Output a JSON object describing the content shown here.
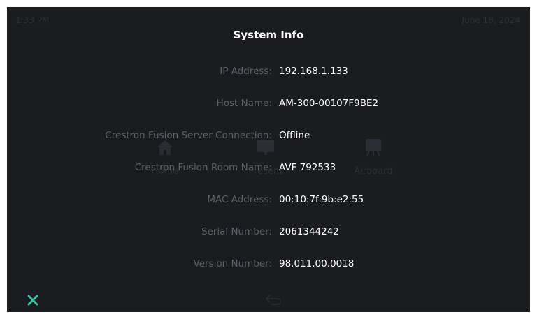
{
  "background": {
    "time": "1:33 PM",
    "date": "June 18, 2024",
    "tiles": [
      {
        "label": "Home",
        "icon": "home-icon"
      },
      {
        "label": "Present",
        "icon": "present-icon"
      },
      {
        "label": "Airboard",
        "icon": "airboard-icon"
      }
    ]
  },
  "dialog": {
    "title": "System Info",
    "rows": [
      {
        "label": "IP Address:",
        "value": "192.168.1.133"
      },
      {
        "label": "Host Name:",
        "value": "AM-300-00107F9BE2"
      },
      {
        "label": "Crestron Fusion Server Connection:",
        "value": "Offline"
      },
      {
        "label": "Crestron Fusion Room Name:",
        "value": "AVF 792533"
      },
      {
        "label": "MAC Address:",
        "value": "00:10:7f:9b:e2:55"
      },
      {
        "label": "Serial Number:",
        "value": "2061344242"
      },
      {
        "label": "Version Number:",
        "value": "98.011.00.0018"
      }
    ],
    "close_icon": "close-icon"
  },
  "colors": {
    "screen_bg": "#1a1c20",
    "label": "#5c6068",
    "value": "#ffffff",
    "accent": "#3fc1a8"
  }
}
